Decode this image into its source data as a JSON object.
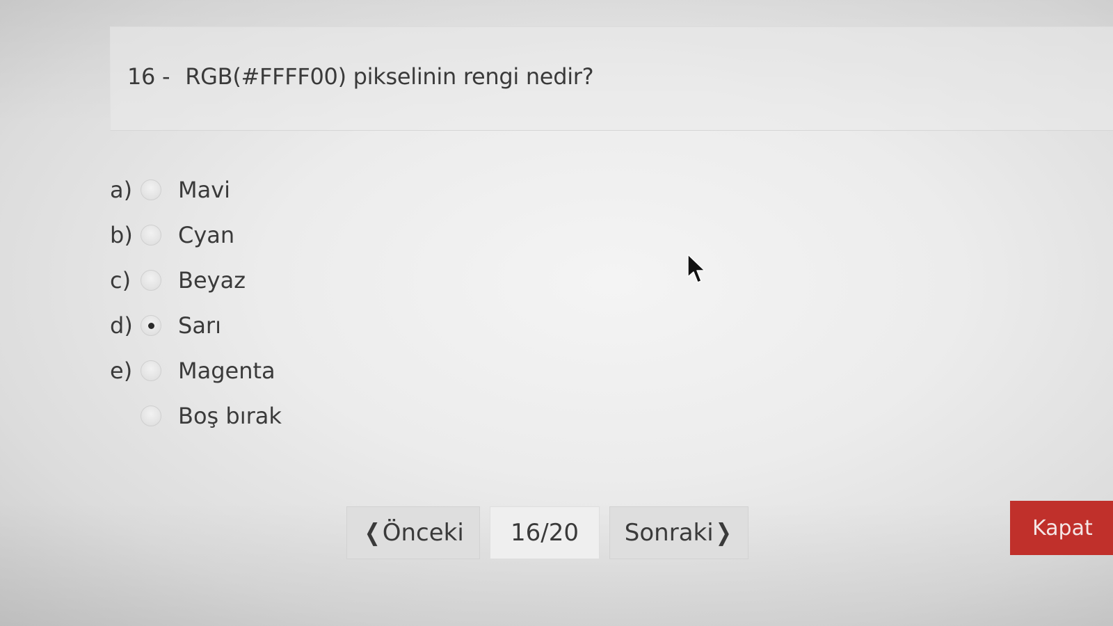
{
  "question": {
    "number": "16 -",
    "text": "RGB(#FFFF00) pikselinin rengi nedir?"
  },
  "options": [
    {
      "letter": "a)",
      "label": "Mavi",
      "selected": false
    },
    {
      "letter": "b)",
      "label": "Cyan",
      "selected": false
    },
    {
      "letter": "c)",
      "label": "Beyaz",
      "selected": false
    },
    {
      "letter": "d)",
      "label": "Sarı",
      "selected": true
    },
    {
      "letter": "e)",
      "label": "Magenta",
      "selected": false
    },
    {
      "letter": "",
      "label": "Boş bırak",
      "selected": false
    }
  ],
  "navigation": {
    "prev_label": "Önceki",
    "page_indicator": "16/20",
    "next_label": "Sonraki",
    "close_label": "Kapat"
  },
  "icons": {
    "prev": "chevron-left-icon",
    "next": "chevron-right-icon",
    "cursor": "mouse-pointer-icon"
  },
  "colors": {
    "close_button": "#c0302b",
    "nav_button": "#dedede"
  }
}
